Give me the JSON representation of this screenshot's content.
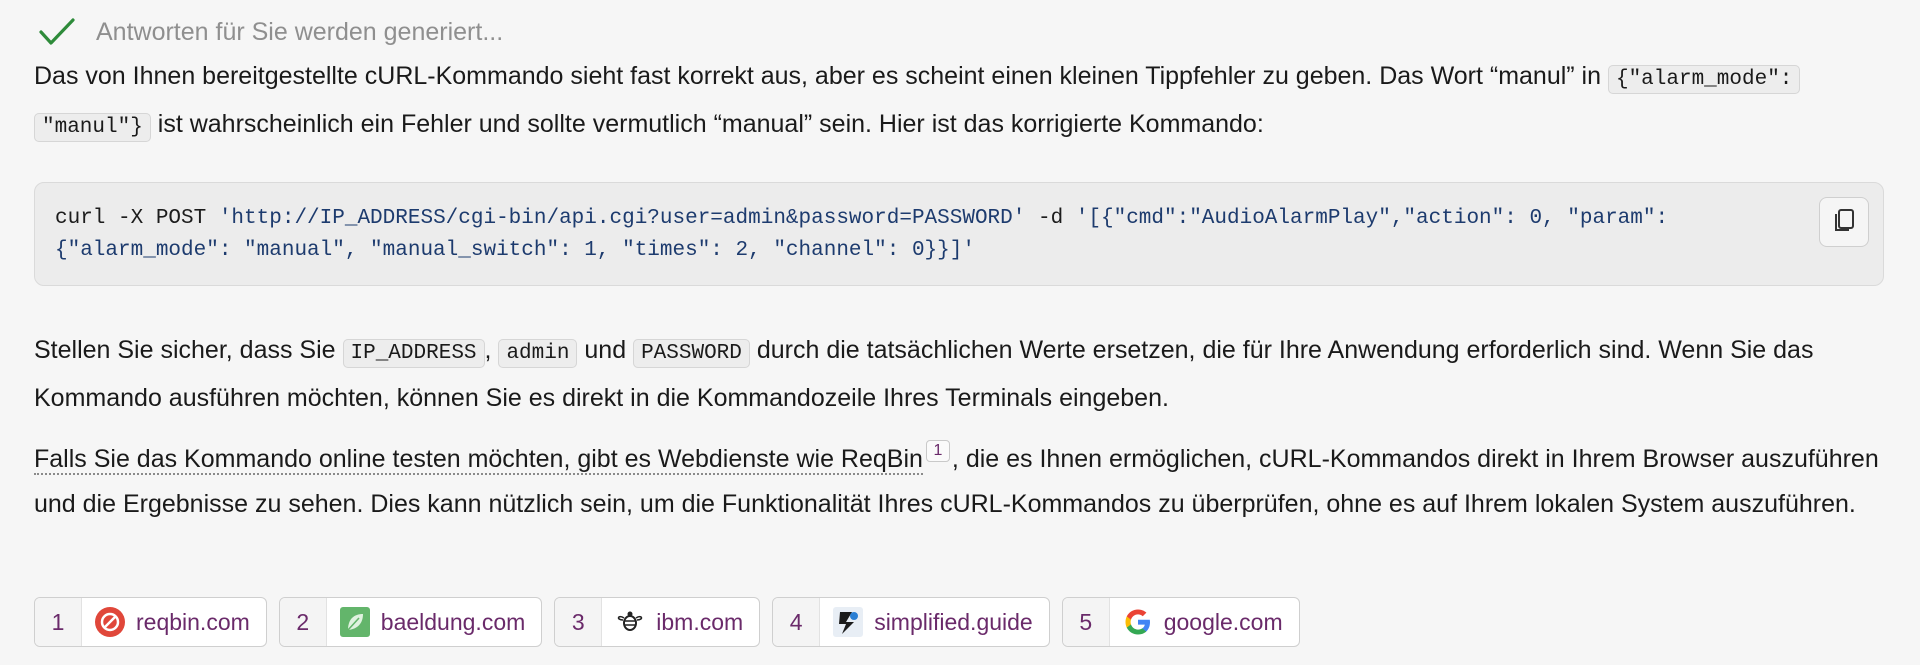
{
  "status": {
    "text": "Antworten für Sie werden generiert..."
  },
  "para1": {
    "before_code": "Das von Ihnen bereitgestellte cURL-Kommando sieht fast korrekt aus, aber es scheint einen kleinen Tippfehler zu geben. Das Wort “manul” in ",
    "code1": "{\"alarm_mode\":",
    "code2": "\"manul\"}",
    "after_code": " ist wahrscheinlich ein Fehler und sollte vermutlich “manual” sein. Hier ist das korrigierte Kommando:"
  },
  "code_block": {
    "line1_cmd": "curl -X POST ",
    "line1_url": "'http://IP_ADDRESS/cgi-bin/api.cgi?user=admin&password=PASSWORD'",
    "line1_flag": " -d ",
    "line1_json": "'[{\"cmd\":\"AudioAlarmPlay\",\"action\": 0, \"param\":",
    "line2_json": "{\"alarm_mode\": \"manual\", \"manual_switch\": 1, \"times\": 2, \"channel\": 0}}]'",
    "copy_icon": "copy-icon"
  },
  "para2": {
    "t1": "Stellen Sie sicher, dass Sie ",
    "c1": "IP_ADDRESS",
    "t2": ", ",
    "c2": "admin",
    "t3": " und ",
    "c3": "PASSWORD",
    "t4": " durch die tatsächlichen Werte ersetzen, die für Ihre Anwendung erforderlich sind. Wenn Sie das Kommando ausführen möchten, können Sie es direkt in die Kommandozeile Ihres Terminals eingeben."
  },
  "para3": {
    "link_text": "Falls Sie das Kommando online testen möchten, gibt es Webdienste wie ReqBin",
    "citation": "1",
    "rest": ", die es Ihnen ermöglichen, cURL-Kommandos direkt in Ihrem Browser auszuführen und die Ergebnisse zu sehen. Dies kann nützlich sein, um die Funktionalität Ihres cURL-Kommandos zu überprüfen, ohne es auf Ihrem lokalen System auszuführen."
  },
  "sources": [
    {
      "num": "1",
      "domain": "reqbin.com",
      "icon": "reqbin-icon"
    },
    {
      "num": "2",
      "domain": "baeldung.com",
      "icon": "baeldung-icon"
    },
    {
      "num": "3",
      "domain": "ibm.com",
      "icon": "ibm-icon"
    },
    {
      "num": "4",
      "domain": "simplified.guide",
      "icon": "simplified-guide-icon"
    },
    {
      "num": "5",
      "domain": "google.com",
      "icon": "google-icon"
    }
  ],
  "colors": {
    "accent_check": "#2e8b3a",
    "source_text": "#6a2a6a",
    "background": "#f6f6f6"
  }
}
